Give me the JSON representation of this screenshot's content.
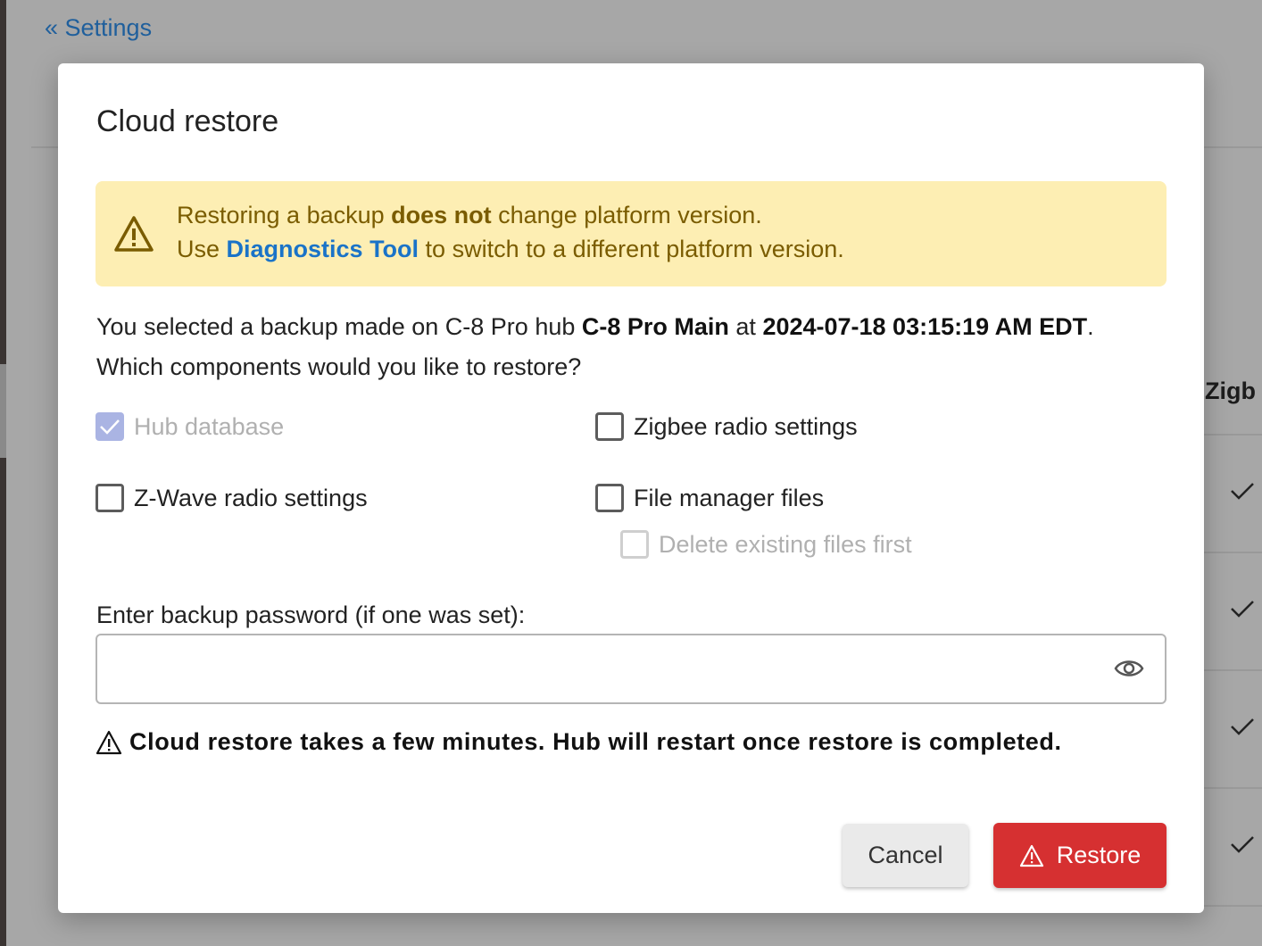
{
  "background": {
    "back_link": "« Settings",
    "column_header": "Zigb"
  },
  "modal": {
    "title": "Cloud restore",
    "alert": {
      "line1_pre": "Restoring a backup ",
      "line1_bold": "does not",
      "line1_post": " change platform version.",
      "line2_pre": "Use ",
      "line2_link": "Diagnostics Tool",
      "line2_post": " to switch to a different platform version."
    },
    "summary": {
      "pre": "You selected a backup made on C-8 Pro hub ",
      "hub_name": "C-8 Pro Main",
      "mid": " at ",
      "timestamp": "2024-07-18 03:15:19 AM EDT",
      "post": "."
    },
    "question": "Which components would you like to restore?",
    "options": {
      "hub_database": "Hub database",
      "zigbee": "Zigbee radio settings",
      "zwave": "Z-Wave radio settings",
      "file_manager": "File manager files",
      "delete_existing": "Delete existing files first"
    },
    "password": {
      "label": "Enter backup password (if one was set):",
      "value": "",
      "placeholder": ""
    },
    "notice": "Cloud restore takes a few minutes. Hub will restart once restore is completed.",
    "buttons": {
      "cancel": "Cancel",
      "restore": "Restore"
    }
  }
}
